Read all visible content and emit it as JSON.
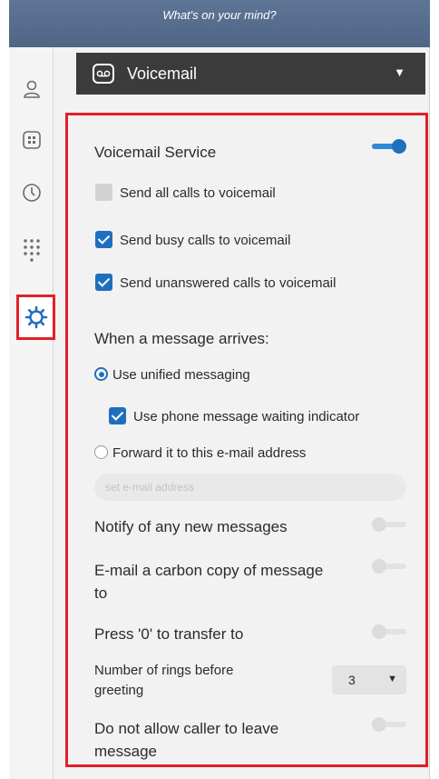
{
  "top_bar": {
    "prompt": "What's on your mind?"
  },
  "sidebar": {
    "items": [
      {
        "icon": "contact-icon"
      },
      {
        "icon": "building-icon"
      },
      {
        "icon": "clock-icon"
      },
      {
        "icon": "dialpad-icon"
      },
      {
        "icon": "gear-icon",
        "active": true
      }
    ]
  },
  "section": {
    "icon": "voicemail-icon",
    "title": "Voicemail",
    "caret": "▼"
  },
  "settings": {
    "voicemail_service": {
      "label": "Voicemail Service",
      "enabled": true
    },
    "send_all": {
      "label": "Send all calls to voicemail",
      "checked": false
    },
    "send_busy": {
      "label": "Send busy calls to voicemail",
      "checked": true
    },
    "send_unanswered": {
      "label": "Send unanswered calls to voicemail",
      "checked": true
    },
    "message_arrives": {
      "label": "When a message arrives:"
    },
    "unified": {
      "label": "Use unified messaging",
      "selected": true
    },
    "mwi": {
      "label": "Use phone message waiting indicator",
      "checked": true
    },
    "forward": {
      "label": "Forward it to this e-mail address",
      "selected": false
    },
    "email": {
      "value": "",
      "placeholder": "set e-mail address"
    },
    "notify": {
      "label": "Notify of any new messages",
      "enabled": false
    },
    "carbon_copy": {
      "line1": "E-mail a carbon copy of message",
      "line2": "to",
      "enabled": false
    },
    "press_zero": {
      "label": "Press '0' to transfer to",
      "enabled": false
    },
    "rings": {
      "line1": "Number of rings before",
      "line2": "greeting",
      "value": "3",
      "arrow": "▼"
    },
    "no_message": {
      "line1": "Do not allow caller to leave",
      "line2": "message",
      "enabled": false
    }
  },
  "colors": {
    "accent": "#1f6fbf",
    "highlight": "#e0202a",
    "header_bg": "#3b3b3b",
    "topbar_bg": "#5a7090"
  }
}
